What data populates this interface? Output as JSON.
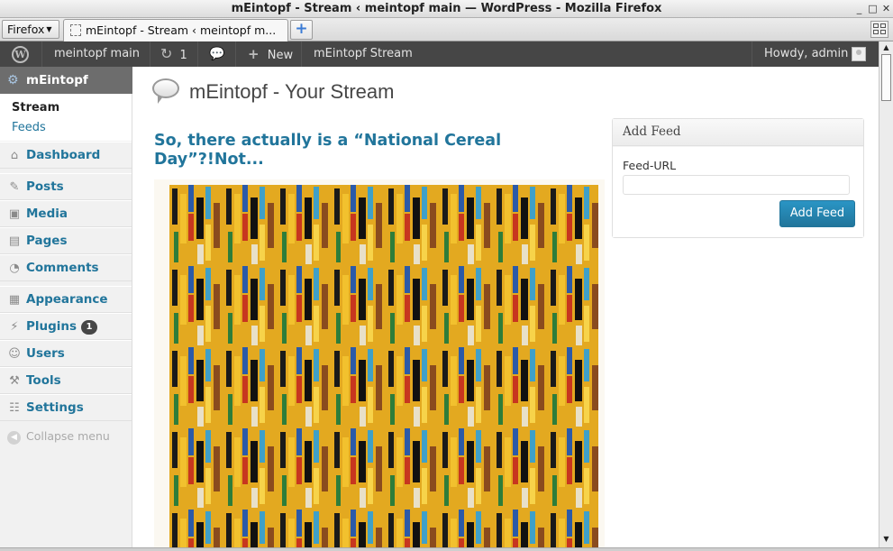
{
  "window": {
    "title": "mEintopf - Stream ‹ meintopf main — WordPress - Mozilla Firefox"
  },
  "browser": {
    "menu_label": "Firefox",
    "tab_title": "mEintopf - Stream ‹ meintopf m..."
  },
  "adminbar": {
    "site_name": "meintopf main",
    "updates_count": "1",
    "new_label": "New",
    "stream_link": "mEintopf Stream",
    "howdy": "Howdy, admin"
  },
  "sidebar": {
    "current_menu": "mEintopf",
    "submenu": [
      "Stream",
      "Feeds"
    ],
    "items": [
      {
        "label": "Dashboard",
        "icon": "dashboard-icon"
      },
      {
        "label": "Posts",
        "icon": "pin-icon"
      },
      {
        "label": "Media",
        "icon": "media-icon"
      },
      {
        "label": "Pages",
        "icon": "pages-icon"
      },
      {
        "label": "Comments",
        "icon": "comments-icon"
      },
      {
        "label": "Appearance",
        "icon": "appearance-icon"
      },
      {
        "label": "Plugins",
        "icon": "plugins-icon",
        "badge": "1"
      },
      {
        "label": "Users",
        "icon": "users-icon"
      },
      {
        "label": "Tools",
        "icon": "tools-icon"
      },
      {
        "label": "Settings",
        "icon": "settings-icon"
      }
    ],
    "collapse_label": "Collapse menu"
  },
  "main": {
    "page_title": "mEintopf - Your Stream",
    "post_title": "So, there actually is a “National Cereal Day”?!Not...",
    "widget": {
      "title": "Add Feed",
      "field_label": "Feed-URL",
      "field_value": "",
      "button_label": "Add Feed"
    }
  },
  "colors": {
    "link": "#21759b",
    "adminbar_bg": "#464646",
    "current_menu_bg": "#6d6d6d",
    "button": "#21759b"
  }
}
